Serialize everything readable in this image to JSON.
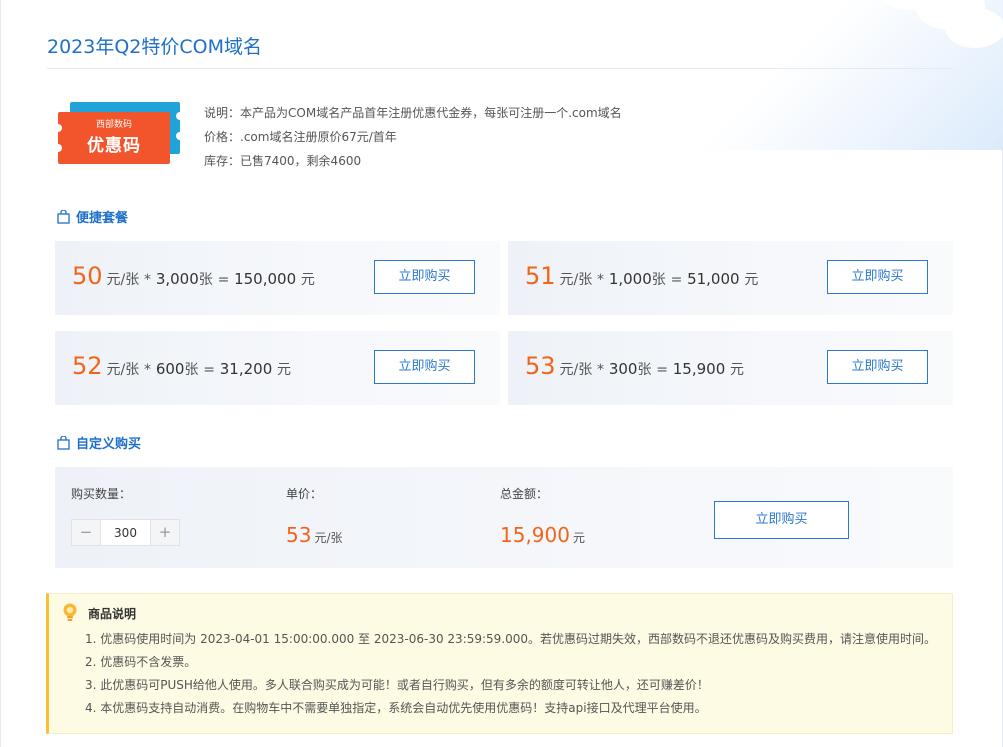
{
  "page": {
    "title": "2023年Q2特价COM域名"
  },
  "coupon_image": {
    "brand": "西部数码",
    "label": "优惠码"
  },
  "info": {
    "desc_label": "说明：",
    "desc": "本产品为COM域名产品首年注册优惠代金券，每张可注册一个.com域名",
    "price_label": "价格：",
    "price": ".com域名注册原价67元/首年",
    "stock_label": "库存：",
    "stock": "已售7400，剩余4600"
  },
  "quick": {
    "title": "便捷套餐",
    "packages": [
      {
        "price": "50",
        "unit": "元/张",
        "times": "*",
        "qty": "3,000",
        "qty_unit": "张",
        "eq": "=",
        "total": "150,000",
        "total_unit": "元",
        "button": "立即购买"
      },
      {
        "price": "51",
        "unit": "元/张",
        "times": "*",
        "qty": "1,000",
        "qty_unit": "张",
        "eq": "=",
        "total": "51,000",
        "total_unit": "元",
        "button": "立即购买"
      },
      {
        "price": "52",
        "unit": "元/张",
        "times": "*",
        "qty": "600",
        "qty_unit": "张",
        "eq": "=",
        "total": "31,200",
        "total_unit": "元",
        "button": "立即购买"
      },
      {
        "price": "53",
        "unit": "元/张",
        "times": "*",
        "qty": "300",
        "qty_unit": "张",
        "eq": "=",
        "total": "15,900",
        "total_unit": "元",
        "button": "立即购买"
      }
    ]
  },
  "custom": {
    "title": "自定义购买",
    "qty_label": "购买数量：",
    "minus": "−",
    "plus": "+",
    "qty_value": "300",
    "unit_price_label": "单价：",
    "unit_price": "53",
    "unit_price_unit": "元/张",
    "total_label": "总金额：",
    "total": "15,900",
    "total_unit": "元",
    "button": "立即购买"
  },
  "notes": {
    "title": "商品说明",
    "items": [
      "1. 优惠码使用时间为 2023-04-01 15:00:00.000 至 2023-06-30 23:59:59.000。若优惠码过期失效，西部数码不退还优惠码及购买费用，请注意使用时间。",
      "2. 优惠码不含发票。",
      "3. 此优惠码可PUSH给他人使用。多人联合购买成为可能！或者自行购买，但有多余的额度可转让他人，还可赚差价！",
      "4. 本优惠码支持自动消费。在购物车中不需要单独指定，系统会自动优先使用优惠码！支持api接口及代理平台使用。"
    ]
  },
  "colors": {
    "accent": "#1f6fc9",
    "price": "#f26419",
    "note_bar": "#f6c033"
  },
  "icons": {
    "section": "shopping-bag-icon",
    "notes": "lightbulb-icon"
  }
}
